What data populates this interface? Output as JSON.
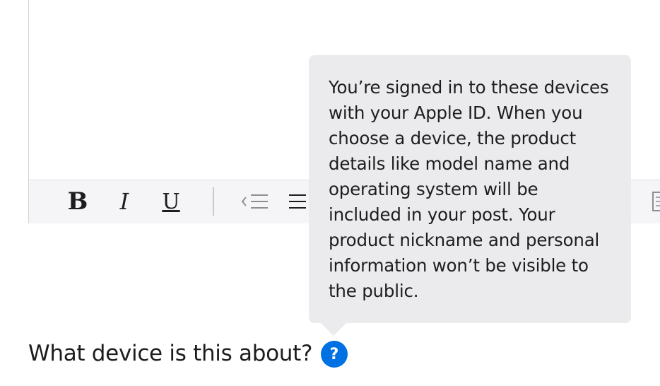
{
  "editor": {
    "toolbar": {
      "bold_label": "B",
      "italic_label": "I",
      "underline_label": "U",
      "outdent_icon": "outdent-icon",
      "list_icon": "bulleted-list-icon",
      "more_icon": "format-icon"
    }
  },
  "tooltip": {
    "text": "You’re signed in to these devices with your Apple ID. When you choose a device, the product details like model name and operating system will be included in your post. Your product nickname and personal information won’t be visible to the public."
  },
  "device_question": {
    "label": "What device is this about?",
    "help_label": "?"
  },
  "colors": {
    "accent": "#0071e3",
    "tooltip_bg": "#ebebed",
    "toolbar_bg": "#f5f5f7",
    "text": "#1d1d1f"
  }
}
